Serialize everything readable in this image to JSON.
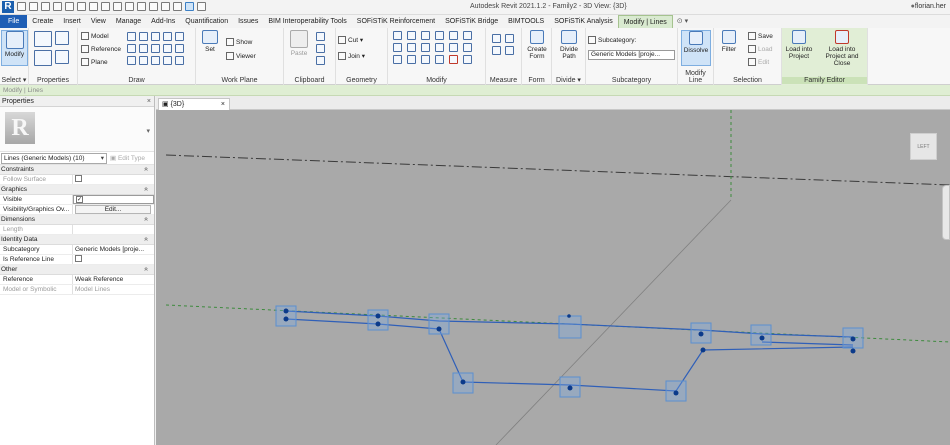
{
  "app": {
    "logo_letter": "R",
    "window_title": "Autodesk Revit 2021.1.2 - Family2 - 3D View: {3D}",
    "user": "florian.her"
  },
  "tabs": [
    "File",
    "Create",
    "Insert",
    "View",
    "Manage",
    "Add-Ins",
    "Quantification",
    "Issues",
    "BIM Interoperability Tools",
    "SOFiSTiK Reinforcement",
    "SOFiSTiK Bridge",
    "BIMTOOLS",
    "SOFiSTiK Analysis",
    "Modify | Lines"
  ],
  "tab_extra": "⊙ ▾",
  "ribbon": {
    "select": {
      "label": "Select ▾",
      "modify": "Modify"
    },
    "properties": {
      "label": "Properties"
    },
    "draw": {
      "label": "Draw",
      "model": "Model",
      "reference": "Reference",
      "plane": "Plane"
    },
    "work_plane": {
      "label": "Work Plane",
      "set": "Set",
      "show": "Show",
      "viewer": "Viewer"
    },
    "clipboard": {
      "label": "Clipboard",
      "paste": "Paste"
    },
    "geometry": {
      "label": "Geometry",
      "cut": "Cut ▾",
      "join": "Join ▾"
    },
    "modify": {
      "label": "Modify"
    },
    "measure": {
      "label": "Measure"
    },
    "create": {
      "label": "Form",
      "create_form": "Create Form"
    },
    "divide": {
      "label": "Divide ▾",
      "divide_path": "Divide Path"
    },
    "subcategory": {
      "label": "Subcategory",
      "caption": "Subcategory:",
      "value": "Generic Models [proje..."
    },
    "modify_line": {
      "label": "Modify Line",
      "dissolve": "Dissolve"
    },
    "selection": {
      "label": "Selection",
      "filter": "Filter",
      "save": "Save",
      "load": "Load",
      "edit": "Edit"
    },
    "family_editor": {
      "label": "Family Editor",
      "load_project": "Load into Project",
      "load_close": "Load into Project and Close"
    }
  },
  "options_bar": "Modify | Lines",
  "properties": {
    "title": "Properties",
    "close": "×",
    "type_logo": "R",
    "type_drop": "▾",
    "selector": "Lines (Generic Models) (10)",
    "edit_type": "Edit Type",
    "groups": {
      "constraints": "Constraints",
      "graphics": "Graphics",
      "dimensions": "Dimensions",
      "identity": "Identity Data",
      "other": "Other"
    },
    "rows": {
      "follow_surface": "Follow Surface",
      "visible": "Visible",
      "vis_graphics": "Visibility/Graphics Ov...",
      "vis_graphics_btn": "Edit...",
      "length": "Length",
      "subcategory": "Subcategory",
      "subcategory_value": "Generic Models [proje...",
      "is_ref_line": "Is Reference Line",
      "reference": "Reference",
      "reference_value": "Weak Reference",
      "model_or_symbolic": "Model or Symbolic",
      "model_or_symbolic_value": "Model Lines"
    }
  },
  "view": {
    "tab_label": "{3D}",
    "tab_close": "×",
    "viewcube_face": "LEFT"
  },
  "colors": {
    "file_tab": "#1e5eb5",
    "contextual_tab": "#d9ead0",
    "viewport_bg": "#a9a9a9",
    "selected_lines": "#2f5fb8",
    "grip": "#0b3a8a"
  }
}
